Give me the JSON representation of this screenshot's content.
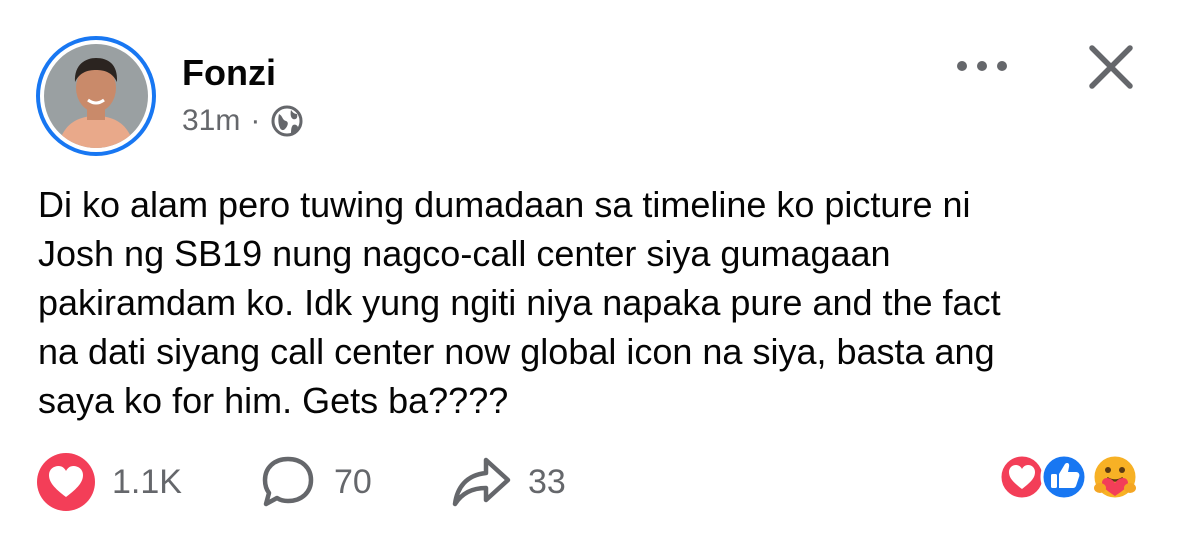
{
  "post": {
    "author": "Fonzi",
    "time": "31m",
    "separator": "·",
    "privacy_icon": "globe-icon",
    "text": "Di ko alam pero tuwing dumadaan sa timeline ko picture ni\nJosh ng SB19 nung nagco-call center siya gumagaan\npakiramdam ko. Idk yung ngiti niya napaka pure and the fact\nna dati siyang call center now global icon na siya, basta ang\nsaya ko for him. Gets ba????"
  },
  "header_actions": {
    "more_icon": "more-horizontal-icon",
    "close_icon": "close-icon"
  },
  "actions": {
    "reactions_count": "1.1K",
    "comments_count": "70",
    "shares_count": "33"
  },
  "reaction_summary": [
    "love-reaction-icon",
    "like-reaction-icon",
    "care-reaction-icon"
  ],
  "colors": {
    "accent": "#1877f2",
    "love": "#f33e58",
    "secondary_text": "#65676b",
    "care": "#f7b125"
  }
}
